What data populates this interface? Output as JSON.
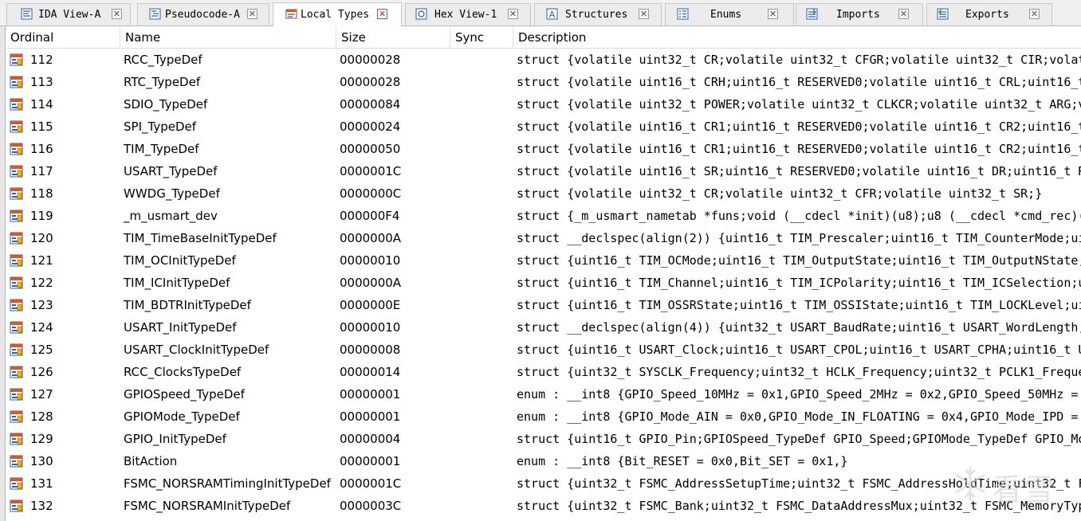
{
  "tabs": [
    {
      "label": "IDA View-A",
      "icon": "ida-view-icon",
      "active": false
    },
    {
      "label": "Pseudocode-A",
      "icon": "pseudocode-icon",
      "active": false
    },
    {
      "label": "Local Types",
      "icon": "local-types-icon",
      "active": true
    },
    {
      "label": "Hex View-1",
      "icon": "hex-view-icon",
      "active": false
    },
    {
      "label": "Structures",
      "icon": "structures-icon",
      "active": false
    },
    {
      "label": "Enums",
      "icon": "enums-icon",
      "active": false
    },
    {
      "label": "Imports",
      "icon": "imports-icon",
      "active": false
    },
    {
      "label": "Exports",
      "icon": "exports-icon",
      "active": false
    }
  ],
  "columns": {
    "ordinal": "Ordinal",
    "name": "Name",
    "size": "Size",
    "sync": "Sync",
    "description": "Description"
  },
  "rows": [
    {
      "ordinal": "112",
      "name": "RCC_TypeDef",
      "size": "00000028",
      "desc": "struct {volatile uint32_t CR;volatile uint32_t CFGR;volatile uint32_t CIR;volat"
    },
    {
      "ordinal": "113",
      "name": "RTC_TypeDef",
      "size": "00000028",
      "desc": "struct {volatile uint16_t CRH;uint16_t RESERVED0;volatile uint16_t CRL;uint16_t"
    },
    {
      "ordinal": "114",
      "name": "SDIO_TypeDef",
      "size": "00000084",
      "desc": "struct {volatile uint32_t POWER;volatile uint32_t CLKCR;volatile uint32_t ARG;v"
    },
    {
      "ordinal": "115",
      "name": "SPI_TypeDef",
      "size": "00000024",
      "desc": "struct {volatile uint16_t CR1;uint16_t RESERVED0;volatile uint16_t CR2;uint16_t"
    },
    {
      "ordinal": "116",
      "name": "TIM_TypeDef",
      "size": "00000050",
      "desc": "struct {volatile uint16_t CR1;uint16_t RESERVED0;volatile uint16_t CR2;uint16_t"
    },
    {
      "ordinal": "117",
      "name": "USART_TypeDef",
      "size": "0000001C",
      "desc": "struct {volatile uint16_t SR;uint16_t RESERVED0;volatile uint16_t DR;uint16_t R"
    },
    {
      "ordinal": "118",
      "name": "WWDG_TypeDef",
      "size": "0000000C",
      "desc": "struct {volatile uint32_t CR;volatile uint32_t CFR;volatile uint32_t SR;}"
    },
    {
      "ordinal": "119",
      "name": "_m_usmart_dev",
      "size": "000000F4",
      "desc": "struct {_m_usmart_nametab *funs;void (__cdecl *init)(u8);u8 (__cdecl *cmd_rec)("
    },
    {
      "ordinal": "120",
      "name": "TIM_TimeBaseInitTypeDef",
      "size": "0000000A",
      "desc": "struct __declspec(align(2)) {uint16_t TIM_Prescaler;uint16_t TIM_CounterMode;ui"
    },
    {
      "ordinal": "121",
      "name": "TIM_OCInitTypeDef",
      "size": "00000010",
      "desc": "struct {uint16_t TIM_OCMode;uint16_t TIM_OutputState;uint16_t TIM_OutputNState;"
    },
    {
      "ordinal": "122",
      "name": "TIM_ICInitTypeDef",
      "size": "0000000A",
      "desc": "struct {uint16_t TIM_Channel;uint16_t TIM_ICPolarity;uint16_t TIM_ICSelection;u"
    },
    {
      "ordinal": "123",
      "name": "TIM_BDTRInitTypeDef",
      "size": "0000000E",
      "desc": "struct {uint16_t TIM_OSSRState;uint16_t TIM_OSSIState;uint16_t TIM_LOCKLevel;ui"
    },
    {
      "ordinal": "124",
      "name": "USART_InitTypeDef",
      "size": "00000010",
      "desc": "struct __declspec(align(4)) {uint32_t USART_BaudRate;uint16_t USART_WordLength;"
    },
    {
      "ordinal": "125",
      "name": "USART_ClockInitTypeDef",
      "size": "00000008",
      "desc": "struct {uint16_t USART_Clock;uint16_t USART_CPOL;uint16_t USART_CPHA;uint16_t U"
    },
    {
      "ordinal": "126",
      "name": "RCC_ClocksTypeDef",
      "size": "00000014",
      "desc": "struct {uint32_t SYSCLK_Frequency;uint32_t HCLK_Frequency;uint32_t PCLK1_Freque"
    },
    {
      "ordinal": "127",
      "name": "GPIOSpeed_TypeDef",
      "size": "00000001",
      "desc": "enum : __int8 {GPIO_Speed_10MHz = 0x1,GPIO_Speed_2MHz = 0x2,GPIO_Speed_50MHz ="
    },
    {
      "ordinal": "128",
      "name": "GPIOMode_TypeDef",
      "size": "00000001",
      "desc": "enum : __int8 {GPIO_Mode_AIN = 0x0,GPIO_Mode_IN_FLOATING = 0x4,GPIO_Mode_IPD ="
    },
    {
      "ordinal": "129",
      "name": "GPIO_InitTypeDef",
      "size": "00000004",
      "desc": "struct {uint16_t GPIO_Pin;GPIOSpeed_TypeDef GPIO_Speed;GPIOMode_TypeDef GPIO_Mo"
    },
    {
      "ordinal": "130",
      "name": "BitAction",
      "size": "00000001",
      "desc": "enum : __int8 {Bit_RESET = 0x0,Bit_SET = 0x1,}"
    },
    {
      "ordinal": "131",
      "name": "FSMC_NORSRAMTimingInitTypeDef",
      "size": "0000001C",
      "desc": "struct {uint32_t FSMC_AddressSetupTime;uint32_t FSMC_AddressHoldTime;uint32_t F"
    },
    {
      "ordinal": "132",
      "name": "FSMC_NORSRAMInitTypeDef",
      "size": "0000003C",
      "desc": "struct {uint32_t FSMC_Bank;uint32_t FSMC_DataAddressMux;uint32_t FSMC_MemoryTyp"
    }
  ],
  "watermark": {
    "text": "看雪",
    "icon": "snowflake-icon"
  }
}
